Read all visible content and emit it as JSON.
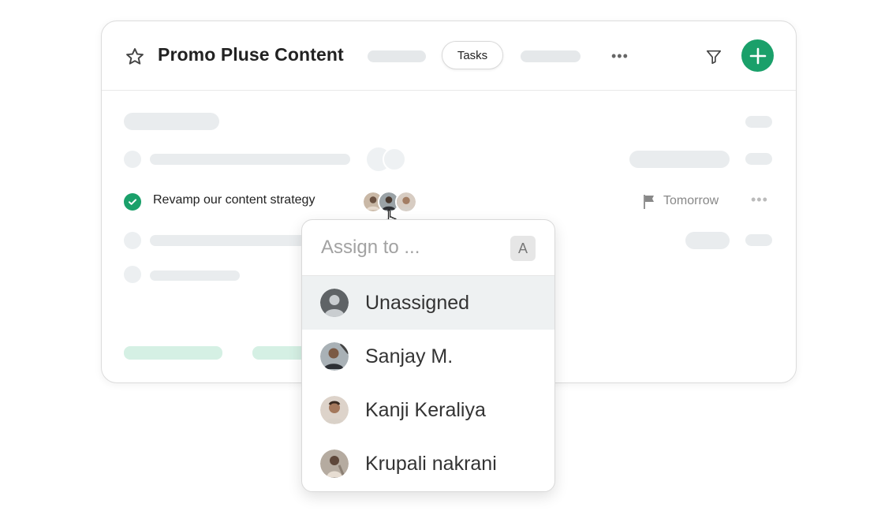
{
  "header": {
    "title": "Promo Pluse Content",
    "tab_tasks": "Tasks",
    "more": "•••"
  },
  "task": {
    "title": "Revamp our content strategy",
    "due": "Tomorrow",
    "more": "•••",
    "status": "completed"
  },
  "assign_menu": {
    "placeholder": "Assign to ...",
    "shortcut": "A",
    "options": [
      {
        "label": "Unassigned",
        "selected": true
      },
      {
        "label": "Sanjay M.",
        "selected": false
      },
      {
        "label": "Kanji Keraliya",
        "selected": false
      },
      {
        "label": "Krupali nakrani",
        "selected": false
      }
    ]
  },
  "colors": {
    "accent": "#1aa06a",
    "skeleton": "#e9ecee",
    "skeleton_green": "#d5f0e4",
    "selected_row": "#eef1f2"
  },
  "icons": [
    "star-icon",
    "filter-icon",
    "plus-icon",
    "check-icon",
    "flag-icon",
    "pointer-cursor-icon",
    "avatar-icon"
  ]
}
